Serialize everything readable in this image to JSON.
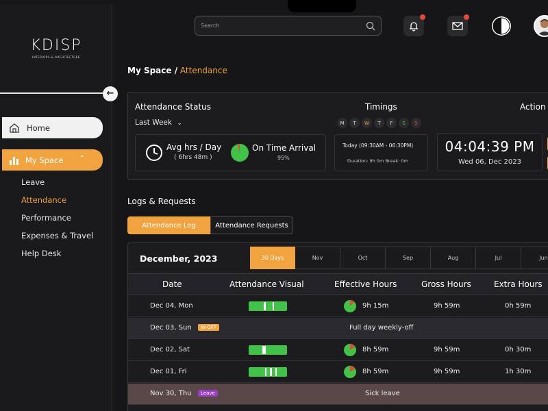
{
  "brand": {
    "logo": "KDISP",
    "tagline": "INTERIORS & ARCHITECTURE"
  },
  "search": {
    "placeholder": "Search"
  },
  "colors": {
    "accent": "#f1a340",
    "success": "#43c24a",
    "danger": "#e24a3a",
    "leave": "#9a3ec0"
  },
  "sidebar": {
    "home": "Home",
    "myspace": "My Space",
    "subitems": [
      "Leave",
      "Attendance",
      "Performance",
      "Expenses & Travel",
      "Help Desk"
    ],
    "active_sub": "Attendance"
  },
  "breadcrumb": {
    "parent": "My Space /",
    "current": " Attendance"
  },
  "status": {
    "title": "Attendance Status",
    "range": "Last Week",
    "timings_title": "Timings",
    "action_title": "Action",
    "days": [
      "M",
      "T",
      "W",
      "T",
      "F",
      "S",
      "S"
    ],
    "avg_label": "Avg hrs / Day",
    "avg_value": "( 6hrs 48m )",
    "ontime_label": "On Time Arrival",
    "ontime_value": "95%",
    "today": "Today  (09:30AM - 06:30PM)",
    "duration": "Duration: 9h 0m     Break: 0m",
    "clock": "04:04:39 PM",
    "date": "Wed 06, Dec 2023"
  },
  "logs": {
    "title": "Logs & Requests",
    "tabs": [
      "Attendance Log",
      "Attendance Requests"
    ],
    "month": "December, 2023",
    "month_tabs": [
      "30 Days",
      "Nov",
      "Oct",
      "Sep",
      "Aug",
      "Jul",
      "Jun"
    ],
    "headers": [
      "Date",
      "Attendance Visual",
      "Effective Hours",
      "Gross Hours",
      "Extra Hours"
    ],
    "rows": [
      {
        "date": "Dec 04, Mon",
        "effective": "9h 15m",
        "gross": "9h 59m",
        "extra": "0h 59m"
      },
      {
        "date": "Dec 03, Sun",
        "badge": "W-OFF",
        "note": "Full day weekly-off"
      },
      {
        "date": "Dec 02, Sat",
        "effective": "8h 59m",
        "gross": "9h 59m",
        "extra": "0h 30m"
      },
      {
        "date": "Dec 01, Fri",
        "effective": "8h 59m",
        "gross": "9h 59m",
        "extra": "1h 30m"
      },
      {
        "date": "Nov 30, Thu",
        "badge": "Leave",
        "note": "Sick leave"
      }
    ]
  }
}
